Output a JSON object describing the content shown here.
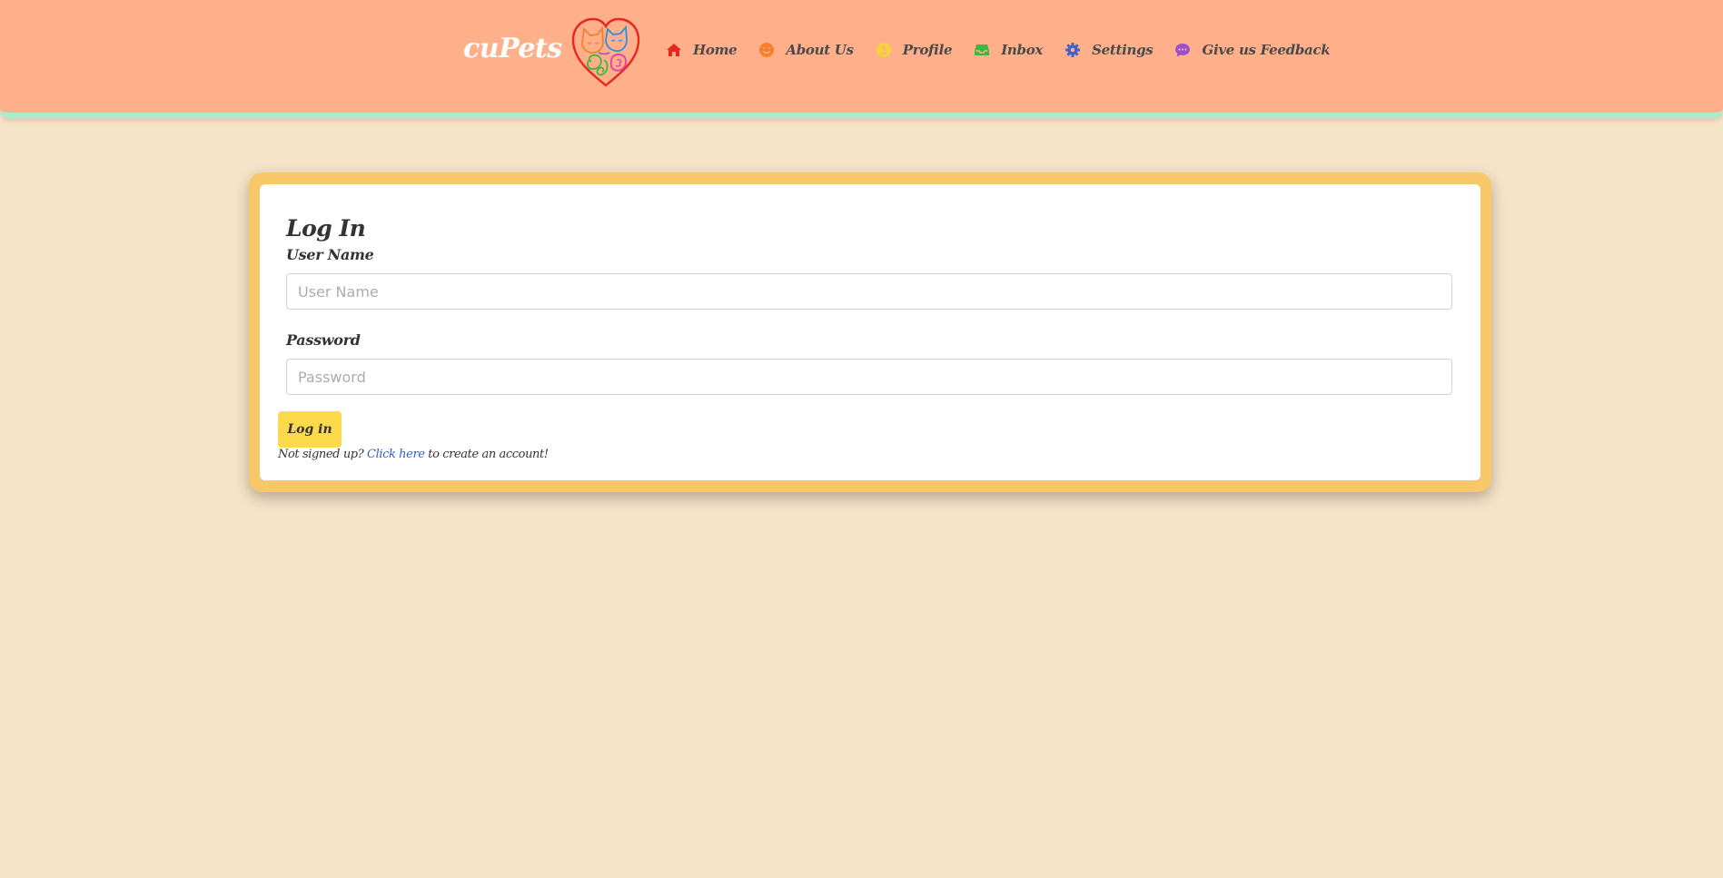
{
  "brand": {
    "name": "cuPets",
    "logo_icon": "heart-pets-logo-icon",
    "colors": {
      "navbar_bg": "#ffb08b",
      "navbar_border": "#a6f0cf",
      "page_bg": "#f6e4c8",
      "card_frame": "#f8c76a",
      "button_bg": "#fdd94c",
      "link": "#2f5fd6"
    }
  },
  "nav": {
    "items": [
      {
        "label": "Home",
        "icon": "home-icon",
        "icon_color": "#e8261f"
      },
      {
        "label": "About Us",
        "icon": "smile-icon",
        "icon_color": "#f57f2c"
      },
      {
        "label": "Profile",
        "icon": "user-circle-icon",
        "icon_color": "#f5d43a"
      },
      {
        "label": "Inbox",
        "icon": "inbox-icon",
        "icon_color": "#3cb93c"
      },
      {
        "label": "Settings",
        "icon": "gear-icon",
        "icon_color": "#3f63c9"
      },
      {
        "label": "Give us Feedback",
        "icon": "chat-bubble-icon",
        "icon_color": "#9a4fd1"
      }
    ]
  },
  "login": {
    "title": "Log In",
    "username_label": "User Name",
    "username_placeholder": "User Name",
    "username_value": "",
    "password_label": "Password",
    "password_placeholder": "Password",
    "password_value": "",
    "submit_label": "Log in",
    "signup_prefix": "Not signed up?",
    "signup_link": "Click here",
    "signup_suffix": "to create an account!"
  }
}
